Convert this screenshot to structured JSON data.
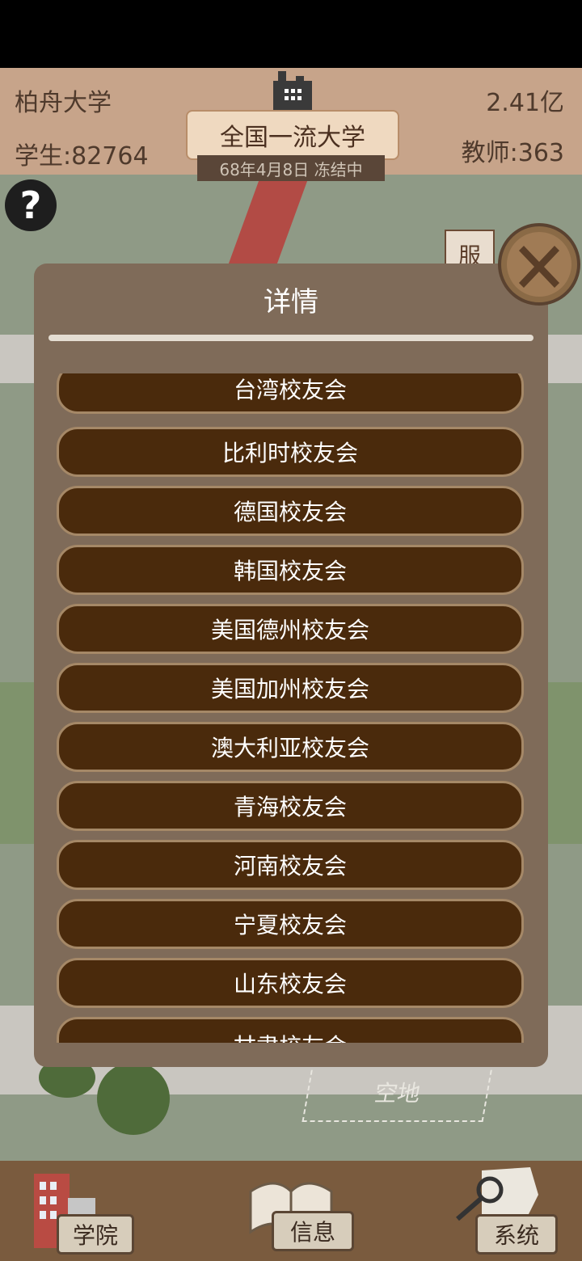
{
  "header": {
    "university_name": "柏舟大学",
    "money": "2.41亿",
    "students": "学生:82764",
    "teachers": "教师:363",
    "rank_title": "全国一流大学",
    "date_status": "68年4月8日 冻结中"
  },
  "map": {
    "side_sign_right": "服",
    "vacant_lot": "空地"
  },
  "help_button": {
    "label": "?"
  },
  "modal": {
    "title": "详情",
    "items": [
      "台湾校友会",
      "比利时校友会",
      "德国校友会",
      "韩国校友会",
      "美国德州校友会",
      "美国加州校友会",
      "澳大利亚校友会",
      "青海校友会",
      "河南校友会",
      "宁夏校友会",
      "山东校友会",
      "甘肃校友会"
    ]
  },
  "bottom_nav": {
    "college": "学院",
    "info": "信息",
    "system": "系统"
  },
  "colors": {
    "header_bg": "#c7a48a",
    "modal_bg": "#7f6b59",
    "item_bg": "#4a2a0c",
    "nav_bg": "#7a5b3e"
  }
}
